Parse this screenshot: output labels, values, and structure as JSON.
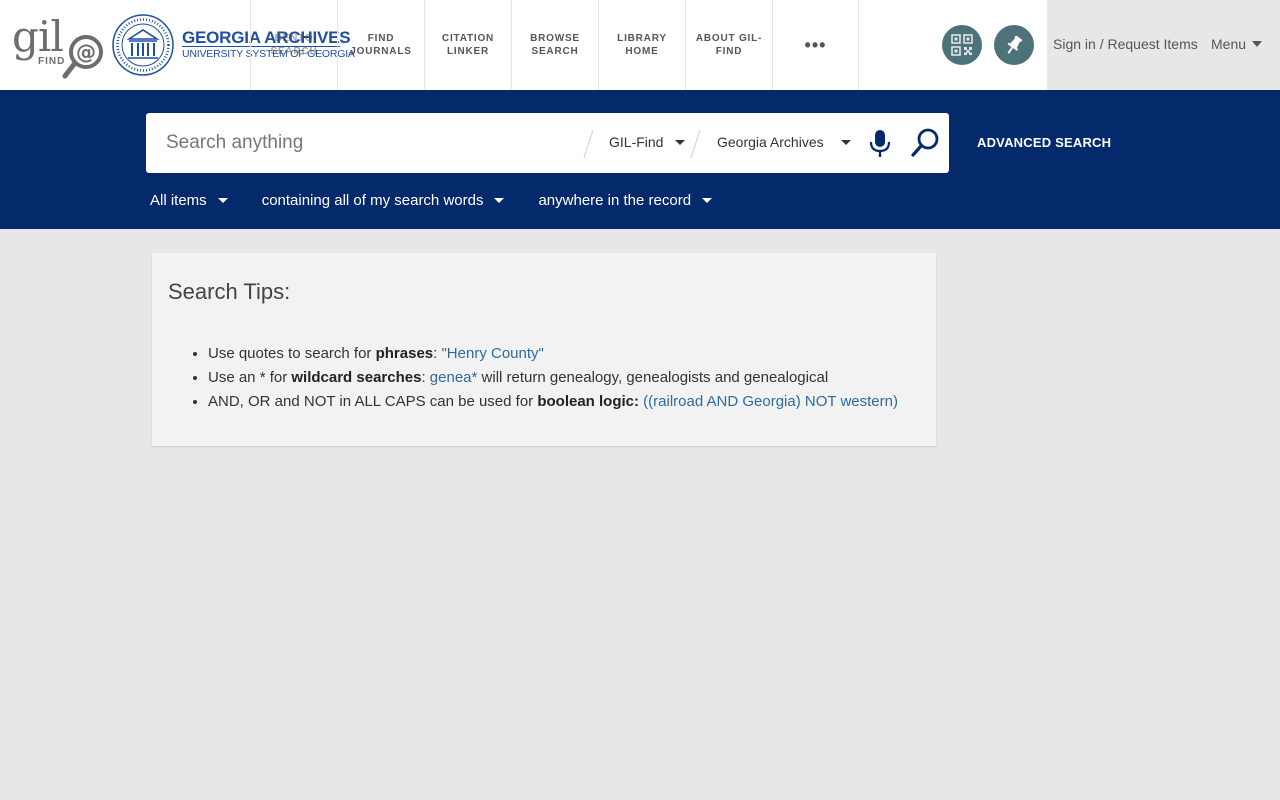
{
  "header": {
    "gil_logo": "gil",
    "gil_find": "FIND",
    "brand_title": "GEORGIA ARCHIVES",
    "brand_subtitle": "UNIVERSITY SYSTEM OF GEORGIA",
    "nav": [
      {
        "label": "BENTO SEARCH"
      },
      {
        "label": "FIND JOURNALS"
      },
      {
        "label": "CITATION LINKER"
      },
      {
        "label": "BROWSE SEARCH"
      },
      {
        "label": "LIBRARY HOME"
      },
      {
        "label": "ABOUT GIL-FIND"
      },
      {
        "label": "•••"
      }
    ],
    "qr_icon": "qr-code-icon",
    "pin_icon": "pushpin-icon",
    "signin": "Sign in / Request Items",
    "menu": "Menu"
  },
  "search": {
    "placeholder": "Search anything",
    "scope_1": "GIL-Find",
    "scope_2": "Georgia Archives",
    "advanced": "ADVANCED SEARCH",
    "filters": {
      "items": "All items",
      "match": "containing all of my search words",
      "field": "anywhere in the record"
    }
  },
  "tips": {
    "title": "Search Tips:",
    "t1_prefix": "Use quotes to search for ",
    "t1_bold": "phrases",
    "t1_colon": ": ",
    "t1_link": "\"Henry County\"",
    "t2_prefix": "Use an * for ",
    "t2_bold": "wildcard searches",
    "t2_colon": ": ",
    "t2_link": "genea*",
    "t2_suffix": " will return genealogy, genealogists and genealogical",
    "t3_prefix": "AND, OR and NOT in ALL CAPS can be used for ",
    "t3_bold": "boolean logic:",
    "t3_space": " ",
    "t3_link": "((railroad AND Georgia) NOT western)"
  },
  "colors": {
    "brand_blue": "#042a6b",
    "link_blue": "#2e6a9e",
    "icon_teal": "#4d7279"
  }
}
